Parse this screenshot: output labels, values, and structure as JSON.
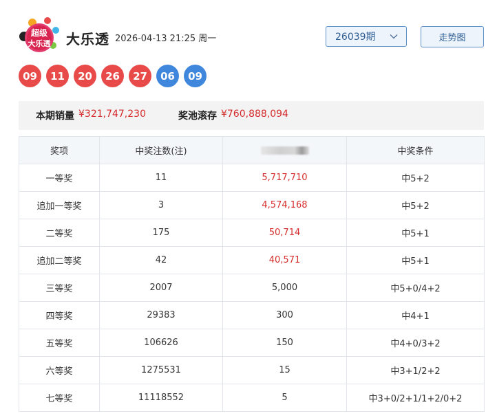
{
  "header": {
    "logo_text_line1": "超级",
    "logo_text_line2": "大乐透",
    "title": "大乐透",
    "draw_time": "2026-04-13 21:25 周一",
    "period_value": "26039期",
    "trend_button_label": "走势图"
  },
  "balls": {
    "front": [
      "09",
      "11",
      "20",
      "26",
      "27"
    ],
    "back": [
      "06",
      "09"
    ],
    "front_color": "#e84a4a",
    "back_color": "#3f86dd"
  },
  "sales": {
    "sales_label": "本期销量",
    "sales_value": "¥321,747,230",
    "pool_label": "奖池滚存",
    "pool_value": "¥760,888,094"
  },
  "table": {
    "headers": [
      "奖项",
      "中奖注数(注)",
      "",
      "中奖条件"
    ],
    "rows": [
      {
        "prize": "一等奖",
        "count": "11",
        "amount": "5,717,710",
        "condition": "中5+2",
        "highlight": true
      },
      {
        "prize": "追加一等奖",
        "count": "3",
        "amount": "4,574,168",
        "condition": "中5+2",
        "highlight": true
      },
      {
        "prize": "二等奖",
        "count": "175",
        "amount": "50,714",
        "condition": "中5+1",
        "highlight": true
      },
      {
        "prize": "追加二等奖",
        "count": "42",
        "amount": "40,571",
        "condition": "中5+1",
        "highlight": true
      },
      {
        "prize": "三等奖",
        "count": "2007",
        "amount": "5,000",
        "condition": "中5+0/4+2",
        "highlight": false
      },
      {
        "prize": "四等奖",
        "count": "29383",
        "amount": "300",
        "condition": "中4+1",
        "highlight": false
      },
      {
        "prize": "五等奖",
        "count": "106626",
        "amount": "150",
        "condition": "中4+0/3+2",
        "highlight": false
      },
      {
        "prize": "六等奖",
        "count": "1275531",
        "amount": "15",
        "condition": "中3+1/2+2",
        "highlight": false
      },
      {
        "prize": "七等奖",
        "count": "11118552",
        "amount": "5",
        "condition": "中3+0/2+1/1+2/0+2",
        "highlight": false
      }
    ]
  },
  "colors": {
    "accent_red": "#d62b2b",
    "button_border": "#5b8fc7",
    "button_bg": "#eef4fb"
  }
}
